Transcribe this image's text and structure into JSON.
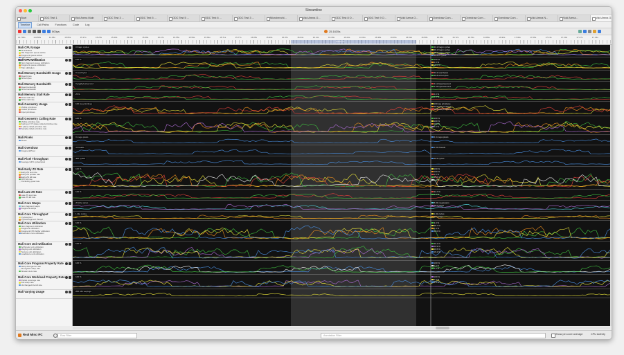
{
  "window": {
    "title": "Streamline"
  },
  "tabs": [
    {
      "label": "Start"
    },
    {
      "label": "ODC Test 1"
    },
    {
      "label": "Void Arena Main"
    },
    {
      "label": "ODC Test 3 ..."
    },
    {
      "label": "ODC Test 5 ..."
    },
    {
      "label": "ODC Test 5 ..."
    },
    {
      "label": "ODC Test 6 ..."
    },
    {
      "label": "ODC Test 3 ..."
    },
    {
      "label": "Microbenchl..."
    },
    {
      "label": "Void Arena O..."
    },
    {
      "label": "ODC Test 8 O..."
    },
    {
      "label": "ODC Test 9 O..."
    },
    {
      "label": "Void Arena O..."
    },
    {
      "label": "Overdraw Com..."
    },
    {
      "label": "Overdraw Com..."
    },
    {
      "label": "Overdraw Com..."
    },
    {
      "label": "Void Arena N..."
    },
    {
      "label": "Void Arena..."
    },
    {
      "label": "Void Arena O..."
    }
  ],
  "subtabs": [
    "Timeline",
    "Call Paths",
    "Functions",
    "Code",
    "Log"
  ],
  "toolbar": {
    "time_value": "25.1635s",
    "zoom": "500µs"
  },
  "ruler": {
    "labels": [
      "14.793s",
      "14.895s",
      "14.95s",
      "15.05s",
      "15.17s",
      "15.25s",
      "15.28s",
      "15.33s",
      "15.39s",
      "15.47s",
      "15.55s",
      "15.59s",
      "15.64s",
      "15.71s",
      "15.77s",
      "15.85s",
      "15.90s",
      "15.97s",
      "16.04s",
      "16.11s",
      "16.18s",
      "16.24s",
      "16.31s",
      "16.38s",
      "16.45s",
      "16.52s",
      "16.58s",
      "16.65s",
      "16.72s",
      "16.79s",
      "16.86s",
      "16.93s",
      "17.00s",
      "17.06s",
      "17.13s",
      "17.20s",
      "17.27s",
      "17.34s"
    ],
    "selection": "2.024 ms"
  },
  "groups": [
    {
      "title": "Mali CPU Usage",
      "series": [
        "All activities",
        "Idle fragment queue active",
        "Fragment queue active",
        "Tiler active",
        "GPU interrupt active"
      ],
      "chip": "0 fragm cycles",
      "legend": [
        "43.1 fragm cycles",
        "49.1 fragm cycles",
        "50.3 fragm cycles",
        "16.8 K cycles"
      ]
    },
    {
      "title": "Mali CPU Utilization",
      "series": [
        "Non-fragment queue utilization",
        "Fragment queue utilization",
        "Tiler utilization"
      ],
      "chip": "100 %",
      "legend": [
        "100 %",
        "0.0 %",
        "16.0 %"
      ]
    },
    {
      "title": "Mali Memory Bandwidth Usage",
      "series": [
        "Read bytes",
        "Write bytes"
      ],
      "chip": "0 read bytes",
      "legend": [
        "53.2 read bytes",
        "46.8 write bytes"
      ]
    },
    {
      "title": "Mali Memory Bandwidth",
      "series": [
        "Read bandwidth",
        "Write bandwidth"
      ],
      "chip": "0 gigabytes/second",
      "legend": [
        "4.11 bytes/second",
        "1.24 bytes/second"
      ]
    },
    {
      "title": "Mali Memory Stall Rate",
      "series": [
        "Read stall rate",
        "Write stall rate"
      ],
      "chip": "25 %",
      "legend": [
        "0.0 %",
        "0.0 %"
      ]
    },
    {
      "title": "Mali Geometry Usage",
      "series": [
        "Visible primitives",
        "Culled primitives",
        "Input primitives"
      ],
      "chip": "100 ksa primitives",
      "legend": [
        "100 ksa primitives",
        "40.6 ksa primitives",
        "15.5 ksa primitives"
      ]
    },
    {
      "title": "Mali Geometry Culling Rate",
      "series": [
        "Visible primitive rate",
        "Facing or XY plane culled primitive rate",
        "Z plane culled primitive rate",
        "Sample culled primitive rate"
      ],
      "chip": "100 %",
      "legend": [
        "100 %",
        "100 %",
        "100 %",
        "0.0 %"
      ]
    },
    {
      "title": "Mali Pixels",
      "series": [
        "Pixels"
      ],
      "chip": "0 mega pixels",
      "legend": [
        "2.4 mega pixels"
      ]
    },
    {
      "title": "Mali Overdraw",
      "series": [
        "Fragment/Pixel"
      ],
      "chip": "4 threads",
      "legend": [
        "1.51 threads"
      ]
    },
    {
      "title": "Mali Pixel Throughput",
      "series": [
        "Average GPU cycles/pixel"
      ],
      "chip": "400 cycles",
      "legend": [
        "49.6 cycles"
      ]
    },
    {
      "title": "Mali Early ZS Rate",
      "series": [
        "Early ZS test rate",
        "Early ZS update rate",
        "Early ZS kill rate",
        "FPK kill rate",
        "Occluding quad rate"
      ],
      "chip": "100 %",
      "legend": [
        "100 %",
        "100 %",
        "0.0 %",
        "25.5 %",
        "0.0 %"
      ]
    },
    {
      "title": "Mali Late ZS Rate",
      "series": [
        "Late ZS test rate",
        "Late ZS kill rate"
      ],
      "chip": "100 %",
      "legend": [
        "34.7 %",
        "0.0 %"
      ]
    },
    {
      "title": "Mali Core Warps",
      "series": [
        "Non-fragment warps",
        "Fragment warps"
      ],
      "chip": "20 ktile warps",
      "legend": [
        "8.03 megawarps",
        "40.7 warps"
      ]
    },
    {
      "title": "Mali Core Throughput",
      "series": [
        "Cycles/pixel",
        "Cycles/fragment thread"
      ],
      "chip": "1 kile cycles",
      "legend": [
        "1.32 cycles",
        "0.0 cycles"
      ]
    },
    {
      "title": "Mali Core Utilization",
      "series": [
        "Non-fragment utilization",
        "Fragment utilization",
        "Fragment FPK buffer utilization",
        "Execution core utilization"
      ],
      "chip": "100 %",
      "legend": [
        "3.3 %",
        "98.7 %",
        "0.4 %",
        "42.0 %"
      ]
    },
    {
      "title": "Mali Core Unit Utilization",
      "series": [
        "Arithmetic unit utilization",
        "Varying unit utilization",
        "Texture unit utilization",
        "Load/store unit utilization"
      ],
      "chip": "100 %",
      "legend": [
        "40.1 %",
        "20.9 %",
        "29.5 %",
        "16.2 %"
      ]
    },
    {
      "title": "Mali Core Program Property Rate",
      "series": [
        "Warp divergence rate",
        "All register warp rate",
        "Shader slots rate"
      ],
      "chip": "100 %",
      "legend": [
        "100 %",
        "0.0 %",
        "0.0 %"
      ]
    },
    {
      "title": "Mali Core Workload Property Rate",
      "series": [
        "Partial coverage rate",
        "Full warp rate",
        "Unchanged tile kill rate"
      ],
      "chip": "100 %",
      "legend": [
        "100 %",
        "0.0 %",
        "0.0 %"
      ]
    },
    {
      "title": "Mali Varying Usage",
      "series": [],
      "chip": "200 16b varyings",
      "legend": []
    }
  ],
  "colors": {
    "green": "#3fbf3f",
    "yellow": "#e8e23a",
    "orange": "#f0901e",
    "purple": "#b06ed8",
    "blue": "#4a8fe0",
    "red": "#e0413b",
    "cyan": "#4fd0d8",
    "white": "#e8e8e8",
    "pink": "#e060b0"
  },
  "status": {
    "title": "Real Misc IFC",
    "filter1": "Row Filter",
    "filter2": "Annotation Filter",
    "checkbox_label": "Show per-core average",
    "dropdown": "CPU Activity"
  }
}
